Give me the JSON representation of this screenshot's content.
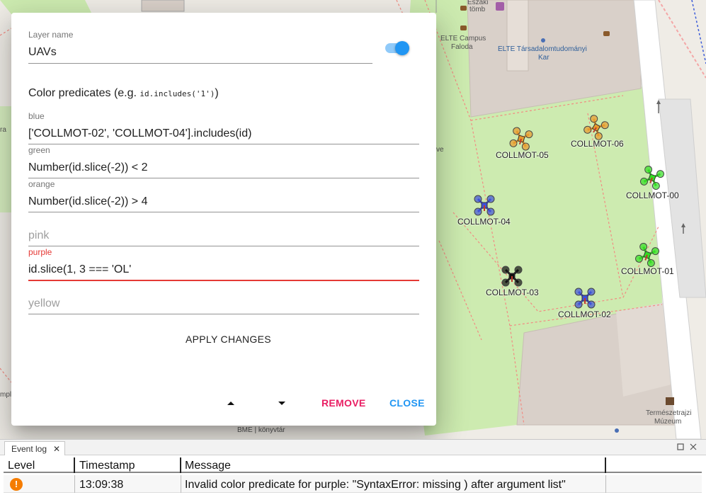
{
  "map": {
    "poi": {
      "eszaki": "Északi",
      "tomb": "tömb",
      "elte_campus": "ELTE Campus",
      "faloda": "Faloda",
      "elte_tarsadalom": "ELTE Társadalomtudományi",
      "kar": "Kar",
      "termeszettudomanyi": "Természetrajzi",
      "muzeum": "Múzeum",
      "bme_konyvtar": "BME | könyvtár",
      "ve": "ve",
      "ra": "ra",
      "mple": "mple"
    },
    "uavs": [
      {
        "id": "COLLMOT-05",
        "color": "#e89a2c"
      },
      {
        "id": "COLLMOT-06",
        "color": "#e89a2c"
      },
      {
        "id": "COLLMOT-00",
        "color": "#33dd22"
      },
      {
        "id": "COLLMOT-04",
        "color": "#3f51d8"
      },
      {
        "id": "COLLMOT-01",
        "color": "#33dd22"
      },
      {
        "id": "COLLMOT-03",
        "color": "#111111"
      },
      {
        "id": "COLLMOT-02",
        "color": "#3f51d8"
      }
    ]
  },
  "dialog": {
    "layer_name_label": "Layer name",
    "layer_name_value": "UAVs",
    "visible": true,
    "predicates_title": "Color predicates (e.g. ",
    "predicates_example": "id.includes('1')",
    "predicates_title_end": ")",
    "fields": {
      "blue": {
        "label": "blue",
        "value": "['COLLMOT-02', 'COLLMOT-04'].includes(id)"
      },
      "green": {
        "label": "green",
        "value": "Number(id.slice(-2)) < 2"
      },
      "orange": {
        "label": "orange",
        "value": "Number(id.slice(-2)) > 4"
      },
      "pink": {
        "placeholder": "pink"
      },
      "purple": {
        "label": "purple",
        "value": "id.slice(1, 3 === 'OL'"
      },
      "yellow": {
        "placeholder": "yellow"
      }
    },
    "apply_label": "APPLY CHANGES",
    "remove_label": "REMOVE",
    "close_label": "CLOSE"
  },
  "event_log": {
    "tab_label": "Event log",
    "tab_close": "✕",
    "columns": [
      "Level",
      "Timestamp",
      "Message"
    ],
    "rows": [
      {
        "level": "warning",
        "level_icon": "!",
        "timestamp": "13:09:38",
        "message": "Invalid color predicate for purple: \"SyntaxError: missing ) after argument list\""
      }
    ]
  },
  "colors": {
    "accent": "#2196f3",
    "remove": "#e91e63",
    "error": "#e53935",
    "warning": "#f57c00"
  }
}
